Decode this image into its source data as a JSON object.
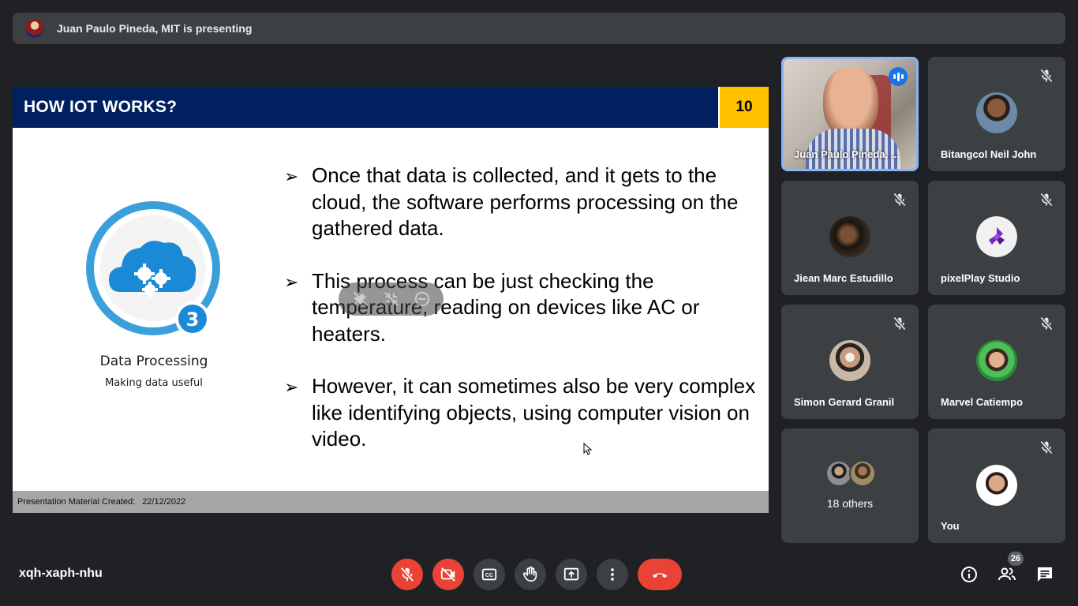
{
  "banner": {
    "presenter_text": "Juan Paulo Pineda, MIT is presenting"
  },
  "slide": {
    "title": "HOW IOT WORKS?",
    "number": "10",
    "step_number": "3",
    "step_title": "Data Processing",
    "step_subtitle": "Making data useful",
    "bullet_marker": "➢",
    "bullets": [
      "Once that data is collected, and it gets to the cloud, the software performs processing on the gathered data.",
      "This process can be just checking the temperature, reading on devices like AC or heaters.",
      "However, it can sometimes also be very complex like identifying objects, using computer vision on video."
    ],
    "footer_label": "Presentation Material Created:",
    "footer_date": "22/12/2022"
  },
  "participants": [
    {
      "name": "Juan Paulo Pineda, ...",
      "state": "speaking",
      "video": true
    },
    {
      "name": "Bitangcol Neil John",
      "state": "muted"
    },
    {
      "name": "Jiean Marc Estudillo",
      "state": "muted"
    },
    {
      "name": "pixelPlay Studio",
      "state": "muted"
    },
    {
      "name": "Simon Gerard Granil",
      "state": "muted"
    },
    {
      "name": "Marvel Catiempo",
      "state": "muted"
    },
    {
      "name": "You",
      "state": "muted"
    }
  ],
  "others_label": "18 others",
  "meeting": {
    "code": "xqh-xaph-nhu",
    "participant_count": "26"
  },
  "controls": [
    "mic-off",
    "camera-off",
    "captions",
    "raise-hand",
    "present",
    "more-options",
    "leave-call"
  ],
  "right_controls": [
    "meeting-details",
    "people",
    "chat"
  ],
  "colors": {
    "background": "#202124",
    "tile": "#3c4043",
    "slide_header": "#002060",
    "slide_number_bg": "#ffc000",
    "danger": "#ea4335",
    "speaking": "#1a73e8",
    "active_border": "#8ab4f8"
  }
}
